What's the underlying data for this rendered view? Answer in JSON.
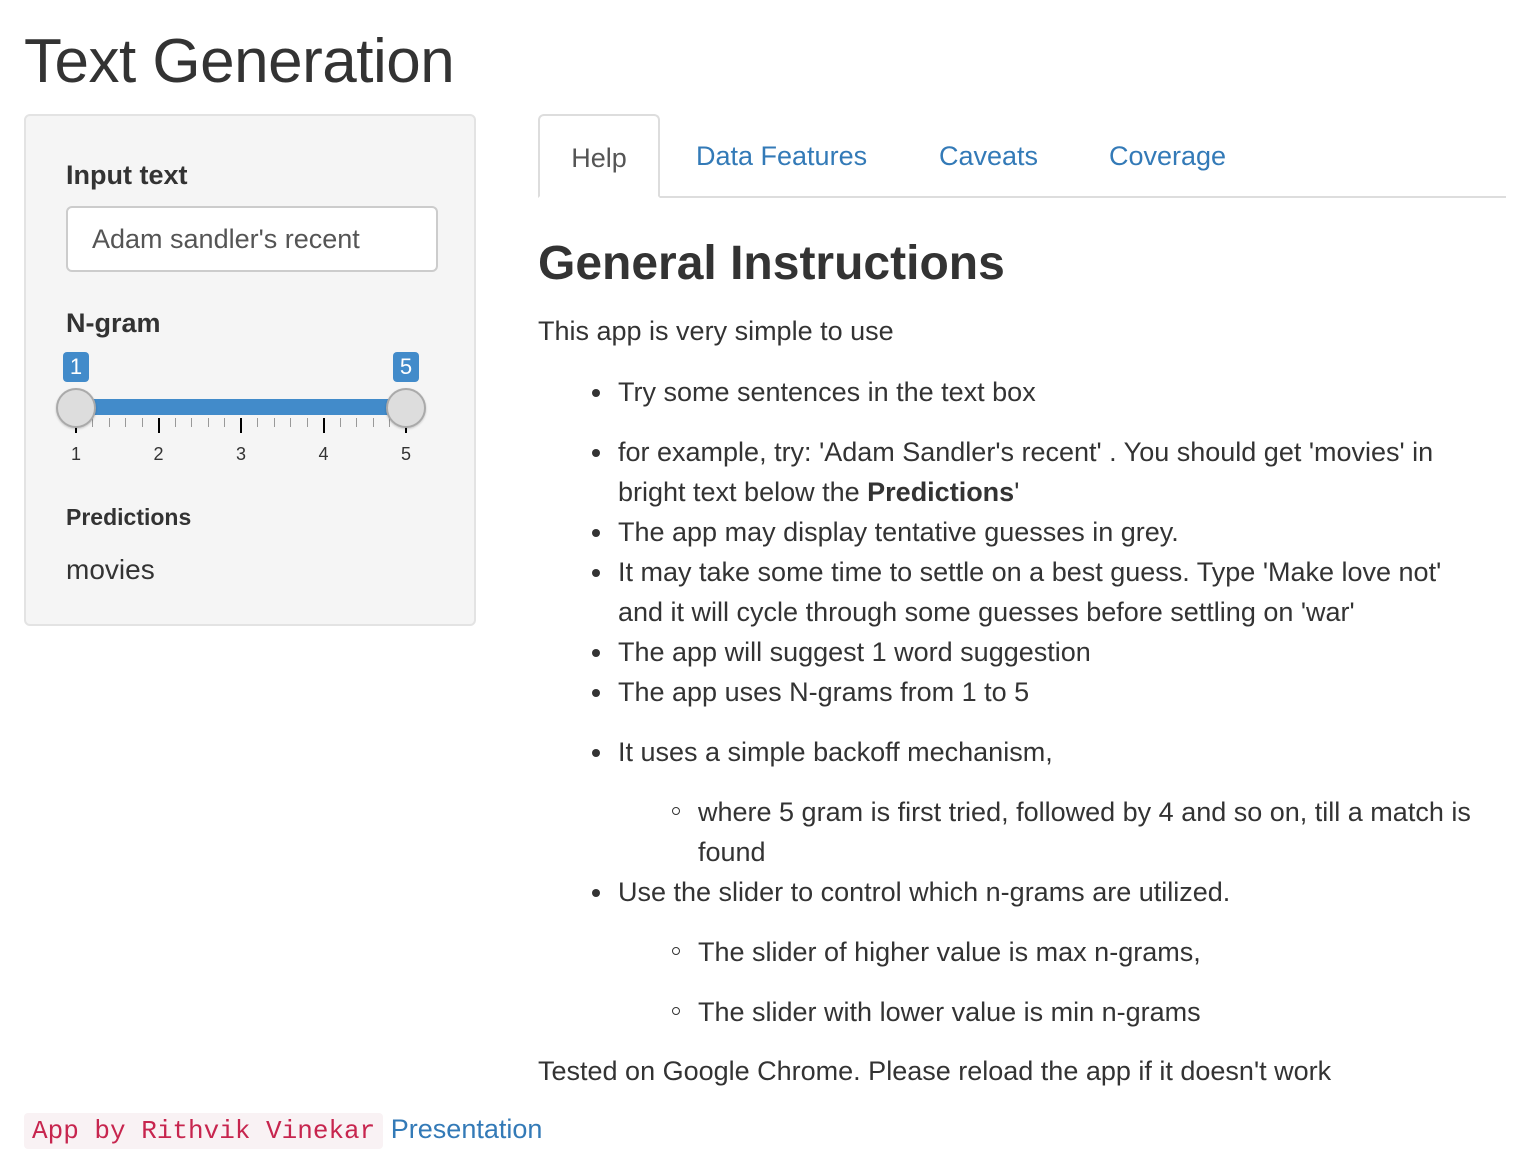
{
  "app": {
    "title": "Text Generation"
  },
  "sidebar": {
    "input_label": "Input text",
    "input_value": "Adam sandler's recent",
    "ngram_label": "N-gram",
    "slider": {
      "min": 1,
      "max": 5,
      "low": 1,
      "high": 5,
      "low_label": "1",
      "high_label": "5",
      "tick_labels": [
        "1",
        "2",
        "3",
        "4",
        "5"
      ],
      "accent": "#428bca"
    },
    "predictions_label": "Predictions",
    "prediction_value": "movies"
  },
  "tabs": [
    {
      "label": "Help",
      "active": true
    },
    {
      "label": "Data Features",
      "active": false
    },
    {
      "label": "Caveats",
      "active": false
    },
    {
      "label": "Coverage",
      "active": false
    }
  ],
  "help": {
    "heading": "General Instructions",
    "intro": "This app is very simple to use",
    "items": [
      "Try some sentences in the text box",
      "for example, try: 'Adam Sandler's recent' . You should get 'movies' in bright text below the ",
      "The app may display tentative guesses in grey.",
      "It may take some time to settle on a best guess. Type 'Make love not' and it will cycle through some guesses before settling on 'war'",
      "The app will suggest 1 word suggestion",
      "The app uses N-grams from 1 to 5",
      "It uses a simple backoff mechanism,",
      "Use the slider to control which n-grams are utilized."
    ],
    "item2_bold": "Predictions",
    "item2_suffix": "'",
    "backoff_sub": "where 5 gram is first tried, followed by 4 and so on, till a match is found",
    "slider_subs": [
      "The slider of higher value is max n-grams,",
      "The slider with lower value is min n-grams"
    ],
    "footer_note": "Tested on Google Chrome. Please reload the app if it doesn't work"
  },
  "footer": {
    "author": "App by Rithvik Vinekar",
    "presentation_link": "Presentation"
  }
}
